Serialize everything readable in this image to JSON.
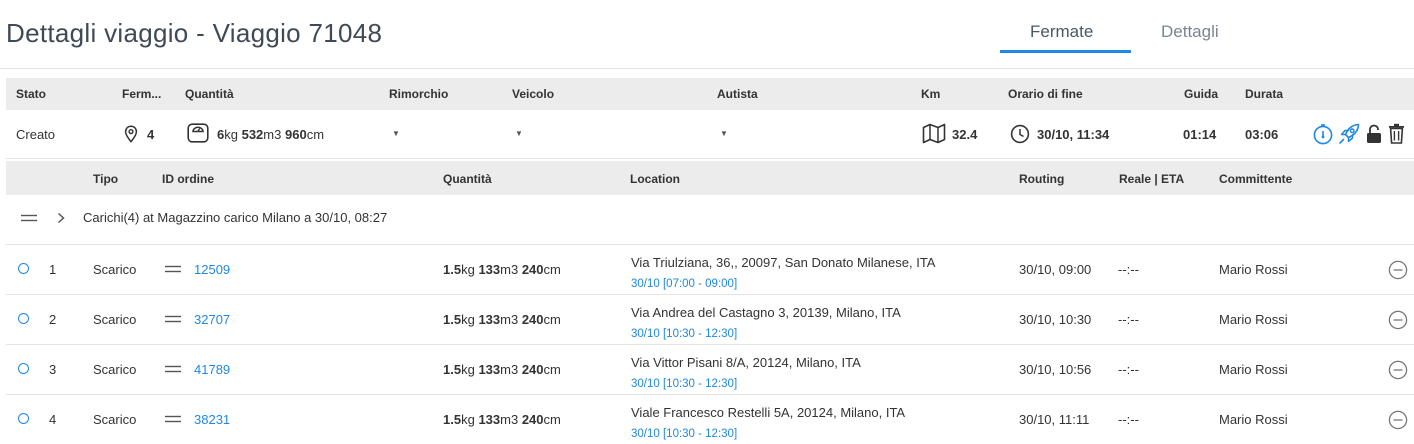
{
  "header": {
    "title": "Dettagli viaggio - Viaggio 71048"
  },
  "tabs": [
    {
      "label": "Fermate",
      "active": true
    },
    {
      "label": "Dettagli",
      "active": false
    }
  ],
  "trip_table": {
    "columns": [
      "Stato",
      "Ferm...",
      "Quantità",
      "Rimorchio",
      "Veicolo",
      "Autista",
      "Km",
      "Orario di fine",
      "Guida",
      "Durata"
    ],
    "row": {
      "stato": "Creato",
      "fermate": "4",
      "qty_kg": "6",
      "qty_kg_unit": "kg",
      "qty_m3": "532",
      "qty_m3_unit": "m3",
      "qty_cm": "960",
      "qty_cm_unit": "cm",
      "km": "32.4",
      "orario_fine": "30/10, 11:34",
      "guida": "01:14",
      "durata": "03:06"
    }
  },
  "stops_table": {
    "columns": [
      "Tipo",
      "ID ordine",
      "Quantità",
      "Location",
      "Routing",
      "Reale | ETA",
      "Committente"
    ],
    "group_label": "Carichi(4) at Magazzino carico Milano a 30/10, 08:27",
    "rows": [
      {
        "num": "1",
        "tipo": "Scarico",
        "id": "12509",
        "kg": "1.5",
        "m3": "133",
        "cm": "240",
        "address": "Via Triulziana, 36,, 20097, San Donato Milanese, ITA",
        "window": "30/10 [07:00 - 09:00]",
        "routing": "30/10, 09:00",
        "eta": "--:--",
        "committente": "Mario Rossi"
      },
      {
        "num": "2",
        "tipo": "Scarico",
        "id": "32707",
        "kg": "1.5",
        "m3": "133",
        "cm": "240",
        "address": "Via Andrea del Castagno 3, 20139, Milano, ITA",
        "window": "30/10 [10:30 - 12:30]",
        "routing": "30/10, 10:30",
        "eta": "--:--",
        "committente": "Mario Rossi"
      },
      {
        "num": "3",
        "tipo": "Scarico",
        "id": "41789",
        "kg": "1.5",
        "m3": "133",
        "cm": "240",
        "address": "Via Vittor Pisani 8/A, 20124, Milano, ITA",
        "window": "30/10 [10:30 - 12:30]",
        "routing": "30/10, 10:56",
        "eta": "--:--",
        "committente": "Mario Rossi"
      },
      {
        "num": "4",
        "tipo": "Scarico",
        "id": "38231",
        "kg": "1.5",
        "m3": "133",
        "cm": "240",
        "address": "Viale Francesco Restelli 5A, 20124, Milano, ITA",
        "window": "30/10 [10:30 - 12:30]",
        "routing": "30/10, 11:11",
        "eta": "--:--",
        "committente": "Mario Rossi"
      }
    ]
  },
  "colors": {
    "accent": "#1e88e5",
    "header_bg": "#ececec",
    "title": "#3f4a56"
  },
  "icons": [
    "map-pin-icon",
    "scale-icon",
    "map-icon",
    "clock-icon",
    "timer-icon",
    "rocket-icon",
    "lock-icon",
    "trash-icon",
    "drag-handle-icon",
    "chevron-right-icon",
    "remove-circle-icon",
    "radio-icon"
  ]
}
